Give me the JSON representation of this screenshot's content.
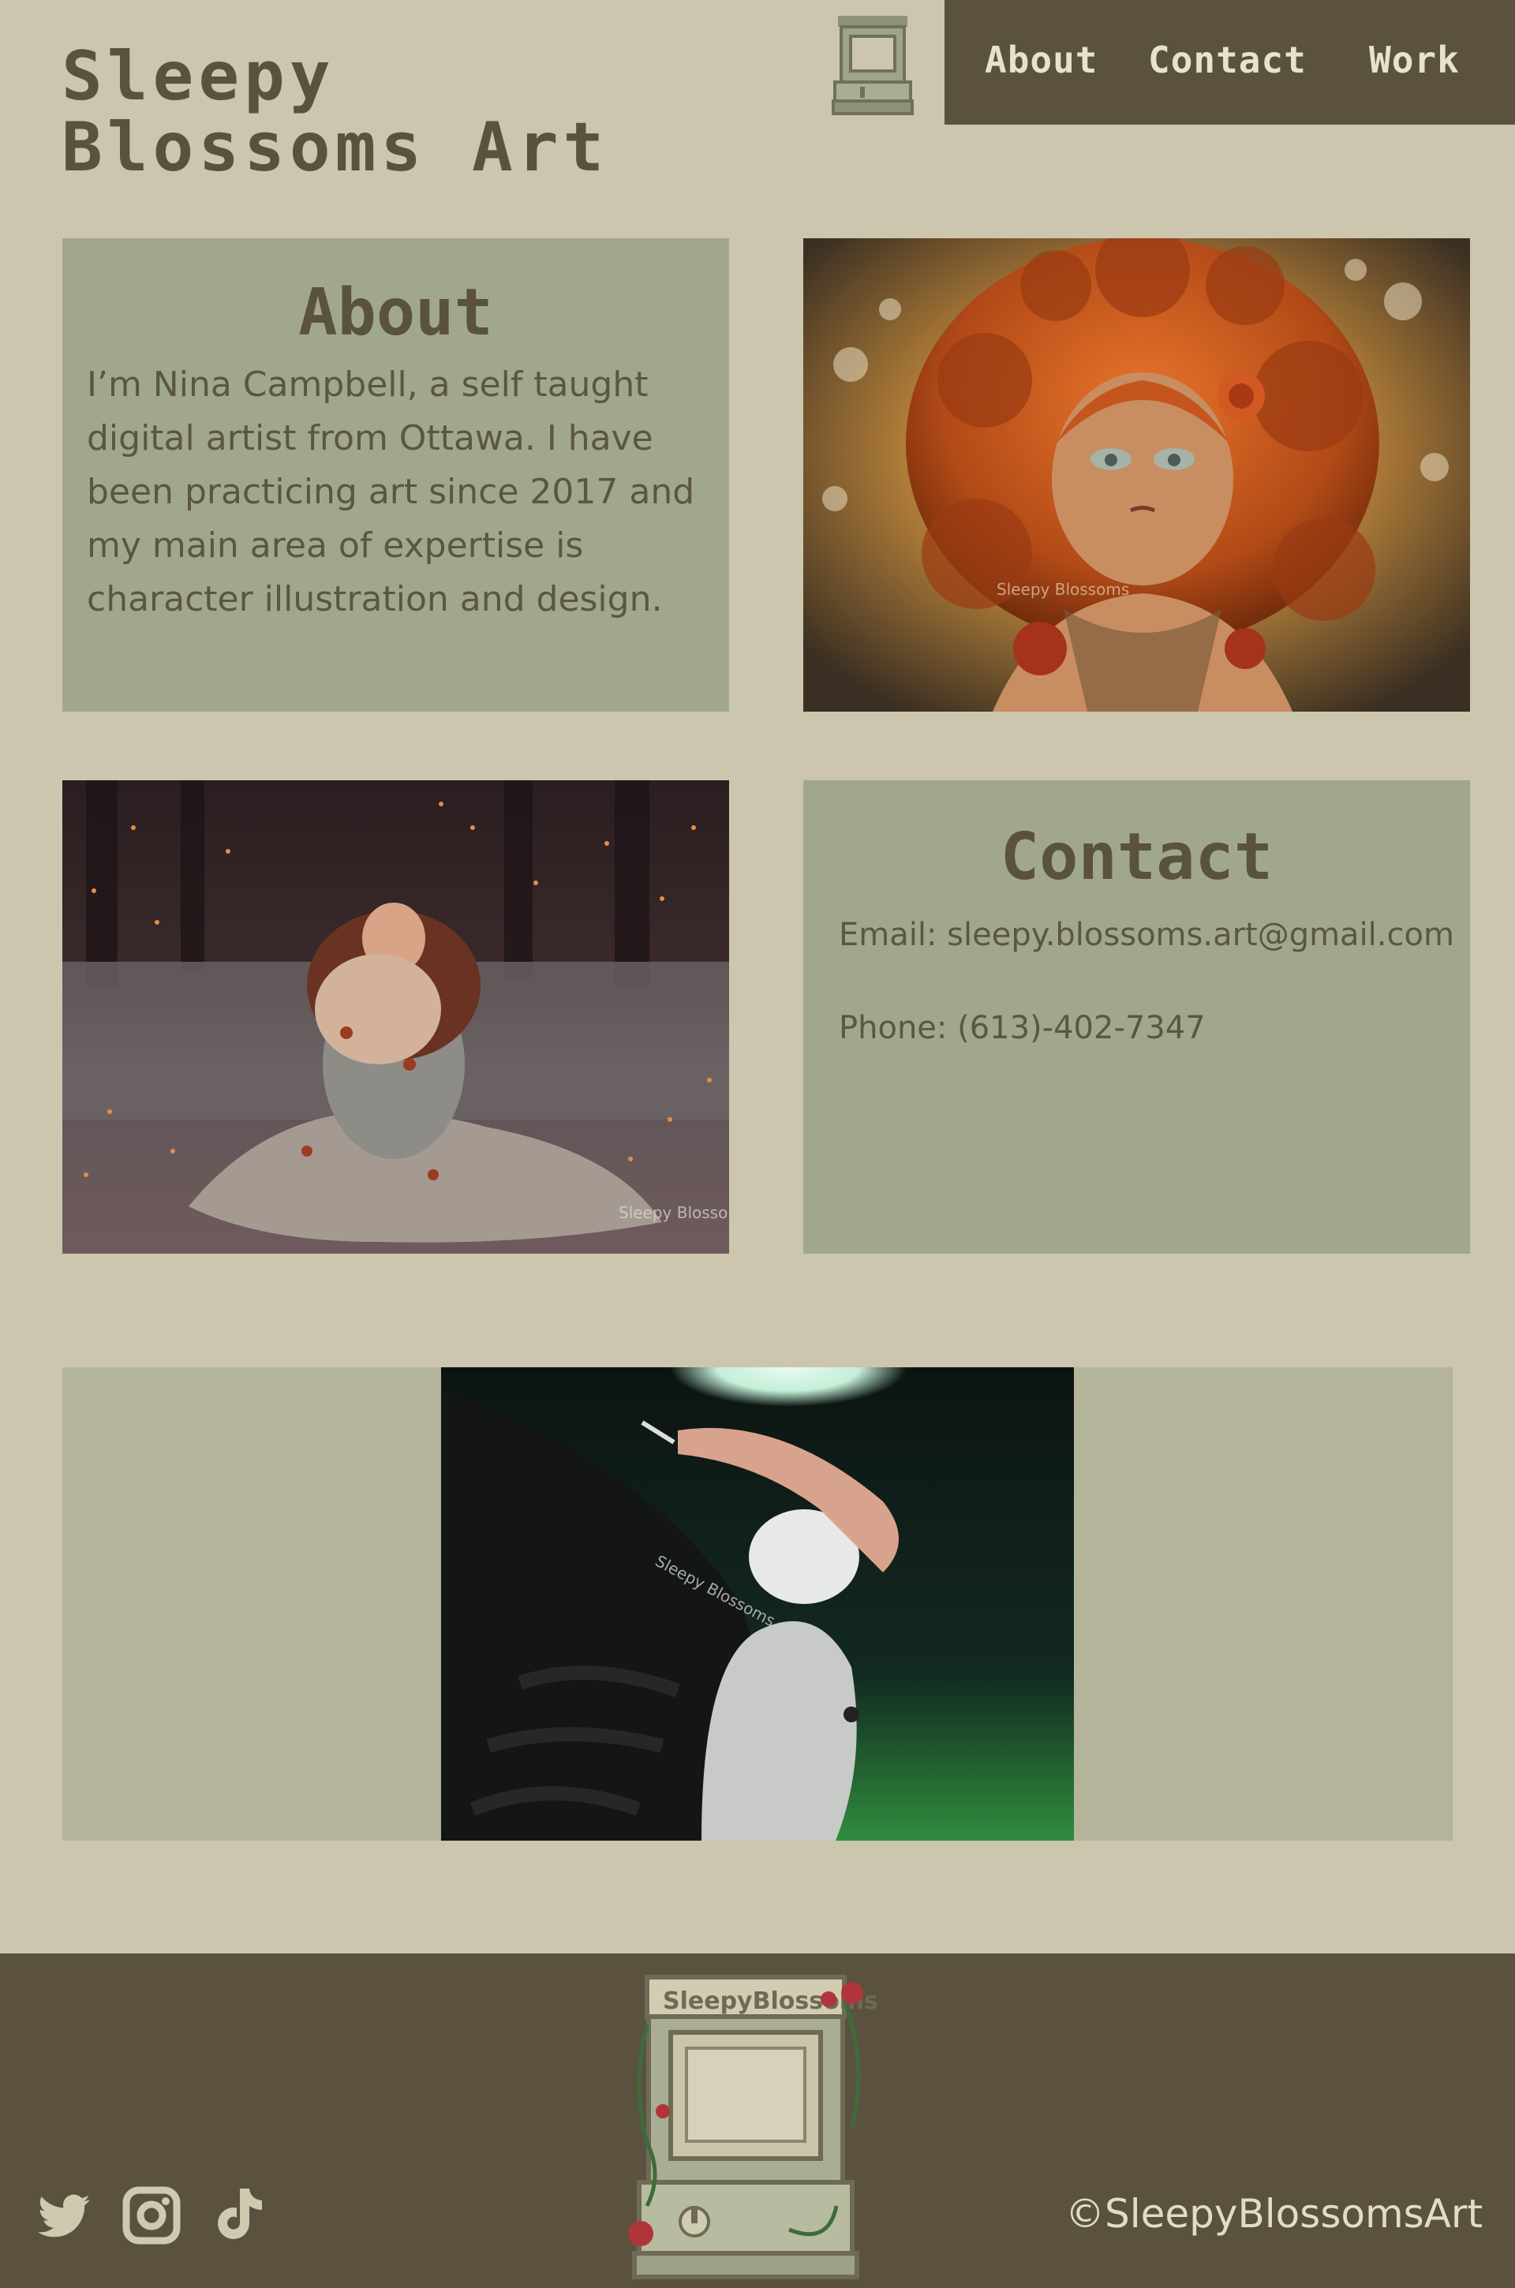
{
  "header": {
    "title_line1": "Sleepy",
    "title_line2": "Blossoms Art",
    "nav": {
      "about": "About",
      "contact": "Contact",
      "work": "Work"
    }
  },
  "about": {
    "heading": "About",
    "body": "I’m Nina Campbell, a self taught digital artist from Ottawa. I have been practicing art since 2017 and my main area of expertise is character illustration and design."
  },
  "contact": {
    "heading": "Contact",
    "email": "Email: sleepy.blossoms.art@gmail.com",
    "phone": "Phone: (613)-402-7347"
  },
  "artworks": {
    "watermark": "Sleepy Blossoms"
  },
  "footer": {
    "arcade_marquee": "SleepyBlossoms",
    "social_icons": [
      "twitter-icon",
      "instagram-icon",
      "tiktok-icon"
    ],
    "copyright": "©SleepyBlossomsArt"
  },
  "colors": {
    "background": "#cbc6ad",
    "panel": "#a1a78c",
    "dark": "#5a523f",
    "nav_text": "#e7e2cc"
  }
}
